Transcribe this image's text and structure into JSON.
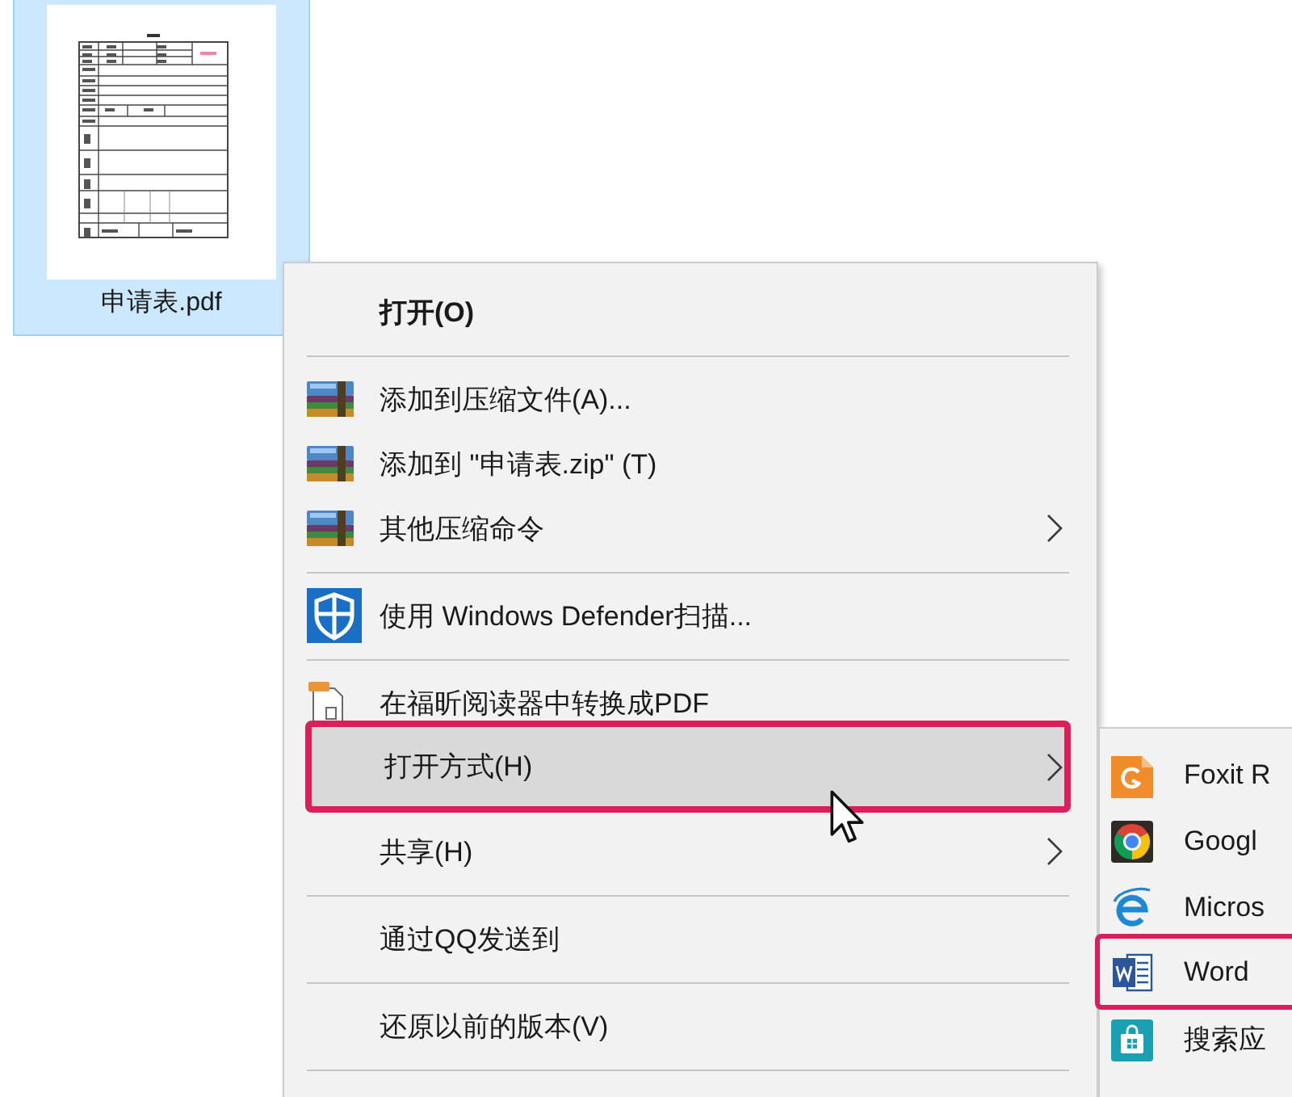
{
  "file": {
    "name": "申请表.pdf",
    "selected": true
  },
  "context_menu": {
    "items": [
      {
        "kind": "item",
        "label": "打开(O)",
        "default": true,
        "submenu": false,
        "selected": false,
        "highlighted": false
      },
      {
        "kind": "separator"
      },
      {
        "kind": "item",
        "label": "添加到压缩文件(A)...",
        "default": false,
        "submenu": false,
        "selected": false,
        "highlighted": false
      },
      {
        "kind": "item",
        "label": "添加到 \"申请表.zip\" (T)",
        "default": false,
        "submenu": false,
        "selected": false,
        "highlighted": false
      },
      {
        "kind": "item",
        "label": "其他压缩命令",
        "default": false,
        "submenu": true,
        "selected": false,
        "highlighted": false
      },
      {
        "kind": "separator"
      },
      {
        "kind": "item",
        "label": "使用 Windows Defender扫描...",
        "default": false,
        "submenu": false,
        "selected": false,
        "highlighted": false
      },
      {
        "kind": "separator"
      },
      {
        "kind": "item",
        "label": "在福昕阅读器中转换成PDF",
        "default": false,
        "submenu": false,
        "selected": false,
        "highlighted": false
      },
      {
        "kind": "item",
        "label": "打开方式(H)",
        "default": false,
        "submenu": true,
        "selected": true,
        "highlighted": true
      },
      {
        "kind": "item",
        "label": "共享(H)",
        "default": false,
        "submenu": true,
        "selected": false,
        "highlighted": false
      },
      {
        "kind": "separator"
      },
      {
        "kind": "item",
        "label": "通过QQ发送到",
        "default": false,
        "submenu": false,
        "selected": false,
        "highlighted": false
      },
      {
        "kind": "separator"
      },
      {
        "kind": "item",
        "label": "还原以前的版本(V)",
        "default": false,
        "submenu": false,
        "selected": false,
        "highlighted": false
      },
      {
        "kind": "separator"
      }
    ]
  },
  "open_with_submenu": {
    "items": [
      {
        "label": "Foxit R",
        "highlighted": false
      },
      {
        "label": "Googl",
        "highlighted": false
      },
      {
        "label": "Micros",
        "highlighted": false
      },
      {
        "label": "Word",
        "highlighted": true
      },
      {
        "label": "搜索应",
        "highlighted": false
      }
    ]
  }
}
